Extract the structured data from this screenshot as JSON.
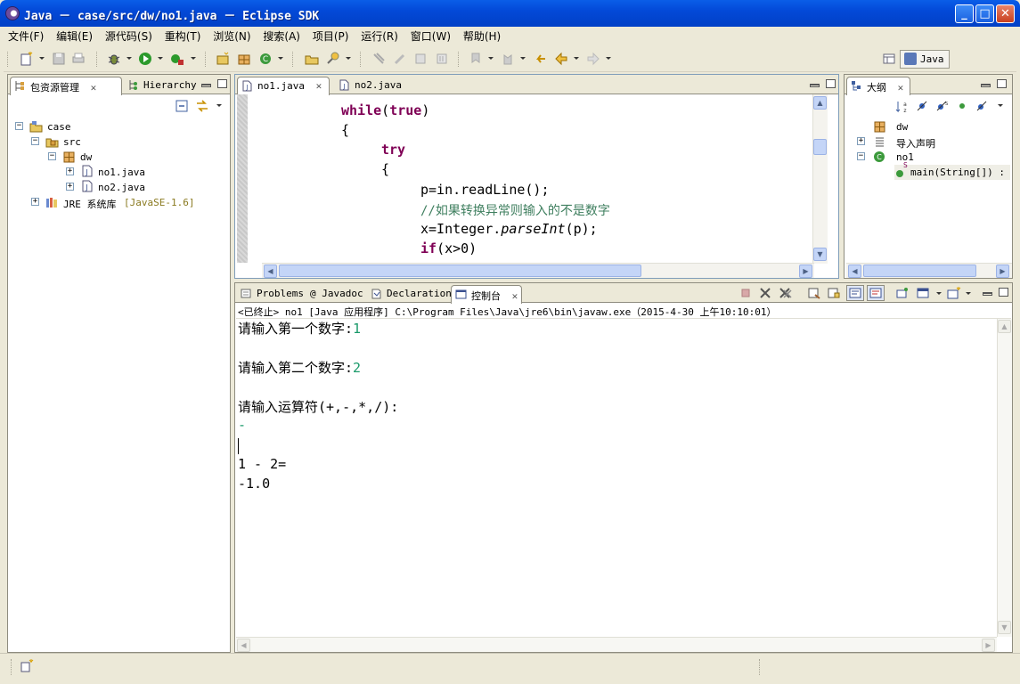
{
  "window": {
    "title": "Java － case/src/dw/no1.java － Eclipse SDK"
  },
  "menu": [
    "文件(F)",
    "编辑(E)",
    "源代码(S)",
    "重构(T)",
    "浏览(N)",
    "搜索(A)",
    "项目(P)",
    "运行(R)",
    "窗口(W)",
    "帮助(H)"
  ],
  "perspective": {
    "label": "Java"
  },
  "package_explorer": {
    "tabs": [
      {
        "label": "包资源管理",
        "close": "✕"
      },
      {
        "label": "Hierarchy"
      }
    ],
    "tree": [
      {
        "label": "case",
        "expander": "−"
      },
      {
        "label": "src",
        "expander": "−"
      },
      {
        "label": "dw",
        "expander": "−"
      },
      {
        "label": "no1.java",
        "expander": "+"
      },
      {
        "label": "no2.java",
        "expander": "+"
      },
      {
        "label": "JRE 系统库",
        "suffix": "[JavaSE-1.6]",
        "expander": "+"
      }
    ]
  },
  "editor": {
    "tabs": [
      {
        "label": "no1.java",
        "close": "✕"
      },
      {
        "label": "no2.java"
      }
    ],
    "code": {
      "while_kw": "while",
      "true_kw": "true",
      "paren_open": "(",
      "paren_close": ")",
      "brace1": "{",
      "try_kw": "try",
      "brace2": "{",
      "line_readline": "p=in.readLine();",
      "comment": "//如果转换异常则输入的不是数字",
      "parse_pre": "x=Integer.",
      "parse_method": "parseInt",
      "parse_post": "(p);",
      "if_kw": "if",
      "if_rest": "(x>0)"
    }
  },
  "outline": {
    "tab": {
      "label": "大纲",
      "close": "✕"
    },
    "tree": [
      {
        "label": "dw"
      },
      {
        "label": "导入声明",
        "expander": "+"
      },
      {
        "label": "no1",
        "expander": "−"
      },
      {
        "label": "main(String[]) :",
        "badge": "S"
      }
    ]
  },
  "bottom": {
    "tabs": [
      {
        "label": "Problems"
      },
      {
        "label": "Javadoc",
        "prefix": "@"
      },
      {
        "label": "Declaration"
      },
      {
        "label": "控制台",
        "close": "✕"
      }
    ],
    "console_header": "<已终止> no1 [Java 应用程序] C:\\Program Files\\Java\\jre6\\bin\\javaw.exe（2015-4-30 上午10:10:01）",
    "console_lines": [
      {
        "prompt": "请输入第一个数字:",
        "input": "1"
      },
      {
        "prompt": "请输入第二个数字:",
        "input": "2"
      },
      {
        "prompt": "请输入运算符(+,-,*,/):",
        "input": ""
      },
      {
        "prompt": "",
        "input": "-"
      },
      {
        "prompt": "1 - 2=",
        "input": ""
      },
      {
        "prompt": "-1.0",
        "input": ""
      }
    ]
  },
  "colors": {
    "title_bar": "#0349d8",
    "keyword": "#7f0055",
    "comment": "#3f7f5f",
    "console_input": "#1a9a6a",
    "bg": "#ece9d8"
  }
}
